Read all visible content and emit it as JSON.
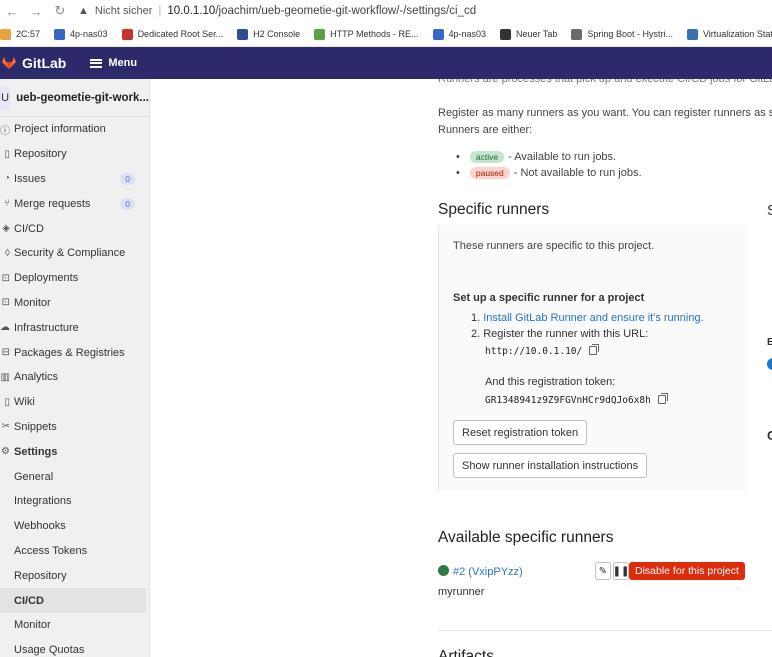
{
  "browser": {
    "warning": "Nicht sicher",
    "url_host": "10.0.1.10",
    "url_path": "/joachim/ueb-geometie-git-workflow/-/settings/ci_cd",
    "bookmarks": [
      {
        "label": "2C:57",
        "color": "#e8a23a"
      },
      {
        "label": "4p-nas03",
        "color": "#3767c4"
      },
      {
        "label": "Dedicated Root Ser...",
        "color": "#c8322f"
      },
      {
        "label": "H2 Console",
        "color": "#2e4d8f"
      },
      {
        "label": "HTTP Methods - RE...",
        "color": "#5aa046"
      },
      {
        "label": "4p-nas03",
        "color": "#3767c4"
      },
      {
        "label": "Neuer Tab",
        "color": "#333333"
      },
      {
        "label": "Spring Boot - Hystri...",
        "color": "#6b6b6b"
      },
      {
        "label": "Virtualization Station",
        "color": "#3a6fb0"
      }
    ]
  },
  "topbar": {
    "brand": "GitLab",
    "menu": "Menu"
  },
  "sidebar": {
    "avatar": "U",
    "project": "ueb-geometie-git-work...",
    "items": [
      {
        "label": "Project information",
        "icon": "info-icon",
        "glyph": "ⓘ"
      },
      {
        "label": "Repository",
        "icon": "doc-icon",
        "glyph": "▯"
      },
      {
        "label": "Issues",
        "icon": "issues-icon",
        "glyph": "◔",
        "count": "0"
      },
      {
        "label": "Merge requests",
        "icon": "merge-icon",
        "glyph": "⑂",
        "count": "0"
      },
      {
        "label": "CI/CD",
        "icon": "rocket-icon",
        "glyph": "◈"
      },
      {
        "label": "Security & Compliance",
        "icon": "shield-icon",
        "glyph": "◊"
      },
      {
        "label": "Deployments",
        "icon": "deploy-icon",
        "glyph": "⊡"
      },
      {
        "label": "Monitor",
        "icon": "monitor-icon",
        "glyph": "⊡"
      },
      {
        "label": "Infrastructure",
        "icon": "cloud-icon",
        "glyph": "☁"
      },
      {
        "label": "Packages & Registries",
        "icon": "package-icon",
        "glyph": "⊟"
      },
      {
        "label": "Analytics",
        "icon": "chart-icon",
        "glyph": "▥"
      },
      {
        "label": "Wiki",
        "icon": "book-icon",
        "glyph": "▯"
      },
      {
        "label": "Snippets",
        "icon": "scissors-icon",
        "glyph": "✂"
      },
      {
        "label": "Settings",
        "icon": "gear-icon",
        "glyph": "⚙",
        "bold": true
      }
    ],
    "sub": [
      "General",
      "Integrations",
      "Webhooks",
      "Access Tokens",
      "Repository",
      "CI/CD",
      "Monitor",
      "Usage Quotas"
    ],
    "active_sub": "CI/CD"
  },
  "main": {
    "intro_line": "Runners are processes that pick up and execute CI/CD jobs for GitLab. H",
    "register_line1": "Register as many runners as you want. You can register runners as separ",
    "register_line2": "Runners are either:",
    "active_badge": "active",
    "active_text": "- Available to run jobs.",
    "paused_badge": "paused",
    "paused_text": "- Not available to run jobs.",
    "specific_title": "Specific runners",
    "right_heading_char": "S",
    "panel_intro": "These runners are specific to this project.",
    "setup_title": "Set up a specific runner for a project",
    "step1_num": "1.",
    "step1_link": "Install GitLab Runner and ensure it's running.",
    "step2": "2. Register the runner with this URL:",
    "url": "http://10.0.1.10/",
    "token_label": "And this registration token:",
    "token": "GR1348941z9Z9FGVnHCr9dQJo6x8h",
    "reset_btn": "Reset registration token",
    "show_btn": "Show runner installation instructions",
    "available_title": "Available specific runners",
    "runner_id": "#2 (VxipPYzz)",
    "runner_name": "myrunner",
    "disable_btn": "Disable for this project",
    "artifacts_title": "Artifacts"
  }
}
